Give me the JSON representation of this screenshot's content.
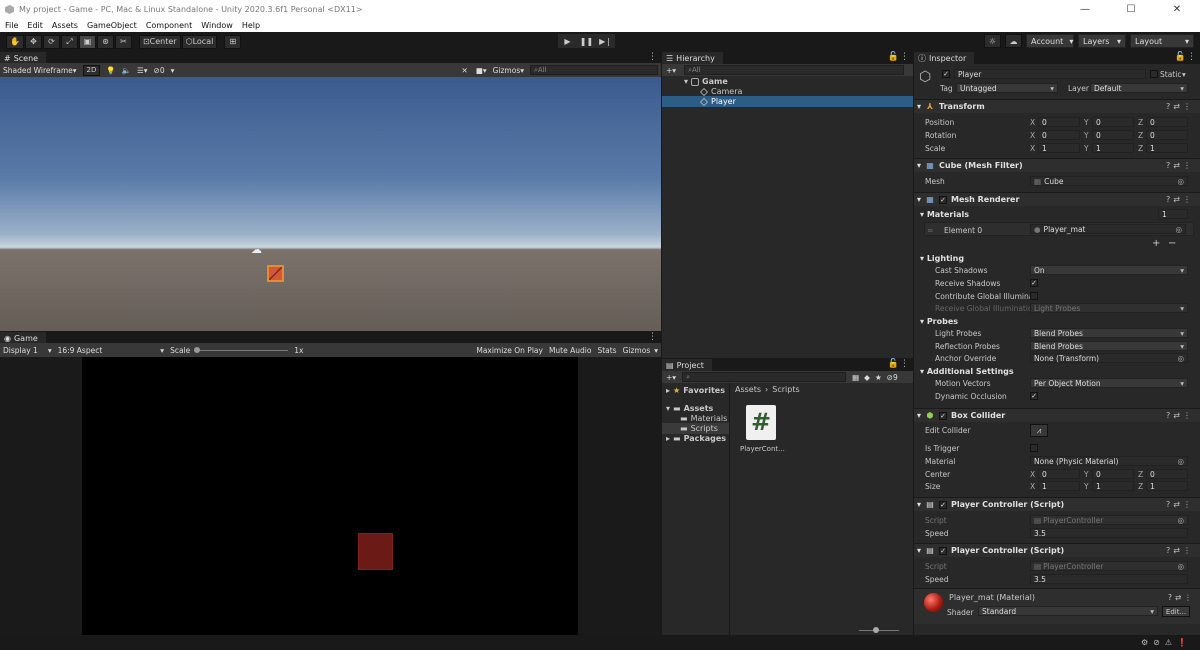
{
  "window": {
    "title": "My project - Game - PC, Mac & Linux Standalone - Unity 2020.3.6f1 Personal <DX11>",
    "minimize": "—",
    "maximize": "☐",
    "close": "✕"
  },
  "menu": [
    "File",
    "Edit",
    "Assets",
    "GameObject",
    "Component",
    "Window",
    "Help"
  ],
  "toolbar": {
    "center": "Center",
    "local": "Local",
    "account": "Account",
    "layers": "Layers",
    "layout": "Layout"
  },
  "scene": {
    "tab": "Scene",
    "shading": "Shaded Wireframe",
    "btn2d": "2D",
    "fx_count": "0",
    "gizmos": "Gizmos",
    "search_placeholder": "All"
  },
  "game": {
    "tab": "Game",
    "display": "Display 1",
    "aspect": "16:9 Aspect",
    "scale_label": "Scale",
    "scale_value": "1x",
    "maximize": "Maximize On Play",
    "mute": "Mute Audio",
    "stats": "Stats",
    "gizmos": "Gizmos"
  },
  "hierarchy": {
    "tab": "Hierarchy",
    "search_placeholder": "All",
    "items": [
      {
        "label": "Game"
      },
      {
        "label": "Camera"
      },
      {
        "label": "Player"
      }
    ]
  },
  "project": {
    "tab": "Project",
    "hidden_count": "9",
    "favorites": "Favorites",
    "assets": "Assets",
    "folders": [
      "Materials",
      "Scripts"
    ],
    "packages": "Packages",
    "breadcrumb": [
      "Assets",
      "Scripts"
    ],
    "file_name": "PlayerCont...",
    "file_glyph": "#"
  },
  "inspector": {
    "tab": "Inspector",
    "object_name": "Player",
    "static": "Static",
    "tag_label": "Tag",
    "tag": "Untagged",
    "layer_label": "Layer",
    "layer": "Default",
    "transform": {
      "title": "Transform",
      "rows": [
        {
          "label": "Position",
          "x": "0",
          "y": "0",
          "z": "0"
        },
        {
          "label": "Rotation",
          "x": "0",
          "y": "0",
          "z": "0"
        },
        {
          "label": "Scale",
          "x": "1",
          "y": "1",
          "z": "1"
        }
      ]
    },
    "mesh_filter": {
      "title": "Cube (Mesh Filter)",
      "mesh_label": "Mesh",
      "mesh": "Cube"
    },
    "mesh_renderer": {
      "title": "Mesh Renderer",
      "materials_label": "Materials",
      "materials_count": "1",
      "element_label": "Element 0",
      "element": "Player_mat",
      "lighting": "Lighting",
      "cast_shadows_label": "Cast Shadows",
      "cast_shadows": "On",
      "receive_shadows_label": "Receive Shadows",
      "contribute_gi_label": "Contribute Global Illuminat",
      "receive_gi_label": "Receive Global Illuminatior",
      "receive_gi": "Light Probes",
      "probes": "Probes",
      "light_probes_label": "Light Probes",
      "light_probes": "Blend Probes",
      "reflection_probes_label": "Reflection Probes",
      "reflection_probes": "Blend Probes",
      "anchor_label": "Anchor Override",
      "anchor": "None (Transform)",
      "additional": "Additional Settings",
      "motion_label": "Motion Vectors",
      "motion": "Per Object Motion",
      "dynamic_occlusion_label": "Dynamic Occlusion"
    },
    "box_collider": {
      "title": "Box Collider",
      "edit_label": "Edit Collider",
      "trigger_label": "Is Trigger",
      "material_label": "Material",
      "material": "None (Physic Material)",
      "center_label": "Center",
      "cx": "0",
      "cy": "0",
      "cz": "0",
      "size_label": "Size",
      "sx": "1",
      "sy": "1",
      "sz": "1"
    },
    "scripts": [
      {
        "title": "Player Controller (Script)",
        "script_label": "Script",
        "script": "PlayerController",
        "speed_label": "Speed",
        "speed": "3.5"
      },
      {
        "title": "Player Controller (Script)",
        "script_label": "Script",
        "script": "PlayerController",
        "speed_label": "Speed",
        "speed": "3.5"
      }
    ],
    "material": {
      "name": "Player_mat (Material)",
      "shader_label": "Shader",
      "shader": "Standard",
      "edit": "Edit..."
    }
  },
  "colors": {
    "selection": "#2c5d87",
    "panel": "#282828",
    "background": "#191919"
  }
}
